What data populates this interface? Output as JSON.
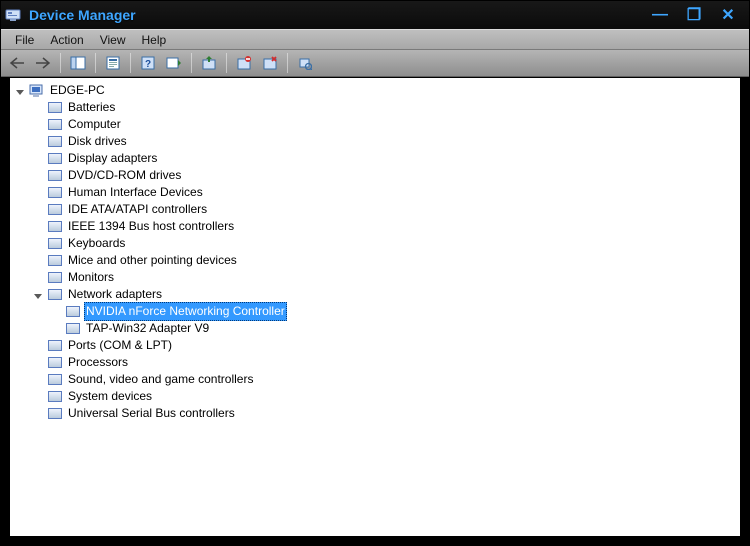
{
  "titlebar": {
    "app_name": "Device Manager"
  },
  "window_controls": {
    "min": "—",
    "max": "❐",
    "close": "✕"
  },
  "menubar": {
    "items": [
      "File",
      "Action",
      "View",
      "Help"
    ]
  },
  "toolbar": {
    "buttons": [
      {
        "name": "nav-back-button",
        "icon": "arrow-left-icon"
      },
      {
        "name": "nav-forward-button",
        "icon": "arrow-right-icon"
      },
      {
        "name": "show-hide-tree-button",
        "icon": "tree-pane-icon"
      },
      {
        "name": "properties-button",
        "icon": "properties-icon"
      },
      {
        "name": "help-button",
        "icon": "help-icon"
      },
      {
        "name": "action-button",
        "icon": "action-icon"
      },
      {
        "name": "update-driver-button",
        "icon": "update-driver-icon"
      },
      {
        "name": "uninstall-button",
        "icon": "uninstall-icon"
      },
      {
        "name": "disable-button",
        "icon": "disable-icon"
      },
      {
        "name": "scan-hardware-button",
        "icon": "scan-hardware-icon"
      }
    ]
  },
  "tree": {
    "root": {
      "label": "EDGE-PC",
      "expanded": true,
      "children": [
        {
          "label": "Batteries",
          "icon": "battery-icon",
          "expanded": false
        },
        {
          "label": "Computer",
          "icon": "computer-icon",
          "expanded": false
        },
        {
          "label": "Disk drives",
          "icon": "disk-icon",
          "expanded": false
        },
        {
          "label": "Display adapters",
          "icon": "display-icon",
          "expanded": false
        },
        {
          "label": "DVD/CD-ROM drives",
          "icon": "optical-icon",
          "expanded": false
        },
        {
          "label": "Human Interface Devices",
          "icon": "hid-icon",
          "expanded": false
        },
        {
          "label": "IDE ATA/ATAPI controllers",
          "icon": "ide-icon",
          "expanded": false
        },
        {
          "label": "IEEE 1394 Bus host controllers",
          "icon": "firewire-icon",
          "expanded": false
        },
        {
          "label": "Keyboards",
          "icon": "keyboard-icon",
          "expanded": false
        },
        {
          "label": "Mice and other pointing devices",
          "icon": "mouse-icon",
          "expanded": false
        },
        {
          "label": "Monitors",
          "icon": "monitor-icon",
          "expanded": false
        },
        {
          "label": "Network adapters",
          "icon": "network-icon",
          "expanded": true,
          "children": [
            {
              "label": "NVIDIA nForce Networking Controller",
              "icon": "nic-icon",
              "selected": true
            },
            {
              "label": "TAP-Win32 Adapter V9",
              "icon": "nic-icon"
            }
          ]
        },
        {
          "label": "Ports (COM & LPT)",
          "icon": "port-icon",
          "expanded": false
        },
        {
          "label": "Processors",
          "icon": "cpu-icon",
          "expanded": false
        },
        {
          "label": "Sound, video and game controllers",
          "icon": "sound-icon",
          "expanded": false
        },
        {
          "label": "System devices",
          "icon": "system-icon",
          "expanded": false
        },
        {
          "label": "Universal Serial Bus controllers",
          "icon": "usb-icon",
          "expanded": false
        }
      ]
    }
  }
}
